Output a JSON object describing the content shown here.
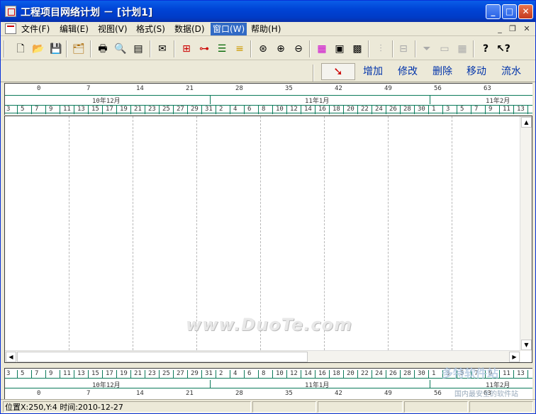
{
  "window": {
    "title": "工程项目网络计划 － [计划1]"
  },
  "menu": [
    {
      "label": "文件(F)"
    },
    {
      "label": "编辑(E)"
    },
    {
      "label": "视图(V)"
    },
    {
      "label": "格式(S)"
    },
    {
      "label": "数据(D)"
    },
    {
      "label": "窗口(W)"
    },
    {
      "label": "帮助(H)"
    }
  ],
  "edit_toolbar": {
    "add": "增加",
    "modify": "修改",
    "delete": "删除",
    "move": "移动",
    "flow": "流水"
  },
  "ruler": {
    "top_weeks": [
      "0",
      "7",
      "14",
      "21",
      "28",
      "35",
      "42",
      "49",
      "56",
      "63"
    ],
    "months": [
      "10年12月",
      "11年1月",
      "11年2月"
    ],
    "days": [
      "3",
      "5",
      "7",
      "9",
      "11",
      "13",
      "15",
      "17",
      "19",
      "21",
      "23",
      "25",
      "27",
      "29",
      "31",
      "2",
      "4",
      "6",
      "8",
      "10",
      "12",
      "14",
      "16",
      "18",
      "20",
      "22",
      "24",
      "26",
      "28",
      "30",
      "1",
      "3",
      "5",
      "7",
      "9",
      "11",
      "13"
    ]
  },
  "bottom_ruler": {
    "days": [
      "3",
      "5",
      "7",
      "9",
      "11",
      "13",
      "15",
      "17",
      "19",
      "21",
      "23",
      "25",
      "27",
      "29",
      "31",
      "2",
      "4",
      "6",
      "8",
      "10",
      "12",
      "14",
      "16",
      "18",
      "20",
      "22",
      "24",
      "26",
      "28",
      "30",
      "1",
      "3",
      "5",
      "7",
      "9",
      "11",
      "13"
    ],
    "months": [
      "10年12月",
      "11年1月",
      "11年2月"
    ],
    "weeks": [
      "0",
      "7",
      "14",
      "21",
      "28",
      "35",
      "42",
      "49",
      "56",
      "63"
    ]
  },
  "watermark": "www.DuoTe.com",
  "watermark_bottom": {
    "logo": "多特软件站",
    "site": "国内最安全的软件站"
  },
  "status": {
    "position": "位置X:250,Y:4 时间:2010-12-27"
  }
}
